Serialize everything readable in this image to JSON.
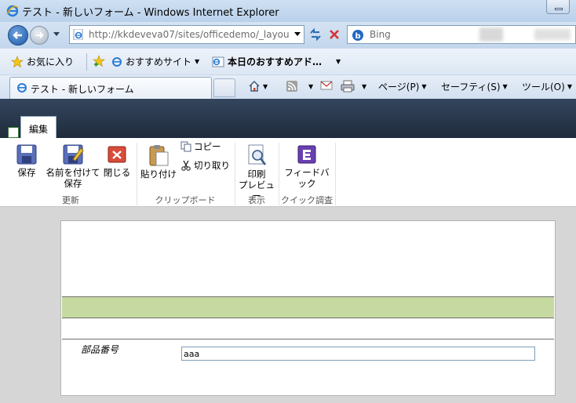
{
  "window": {
    "title": "テスト - 新しいフォーム - Windows Internet Explorer"
  },
  "navigation": {
    "address_url": "http://kkdeveva07/sites/officedemo/_layou",
    "address_host": "kkdeveva07",
    "search_provider": "Bing"
  },
  "favorites_bar": {
    "favorites_label": "お気に入り",
    "suggested_sites_label": "おすすめサイト",
    "daily_picks_label": "本日のおすすめアド…"
  },
  "tabs": [
    {
      "label": "テスト - 新しいフォーム"
    }
  ],
  "command_bar": {
    "page_label": "ページ(P)",
    "safety_label": "セーフティ(S)",
    "tools_label": "ツール(O)"
  },
  "ribbon": {
    "active_tab": "編集",
    "groups": {
      "update": {
        "label": "更新",
        "save": "保存",
        "save_as_line1": "名前を付けて",
        "save_as_line2": "保存",
        "close": "閉じる"
      },
      "clipboard": {
        "label": "クリップボード",
        "paste": "貼り付け",
        "copy": "コピー",
        "cut": "切り取り"
      },
      "view": {
        "label": "表示",
        "print_preview_line1": "印刷",
        "print_preview_line2": "プレビュー"
      },
      "quick_survey": {
        "label": "クイック調査",
        "feedback": "フィードバック"
      }
    }
  },
  "form": {
    "field_label": "部品番号",
    "field_value": "aaa",
    "band_color": "#c6d9a0"
  }
}
